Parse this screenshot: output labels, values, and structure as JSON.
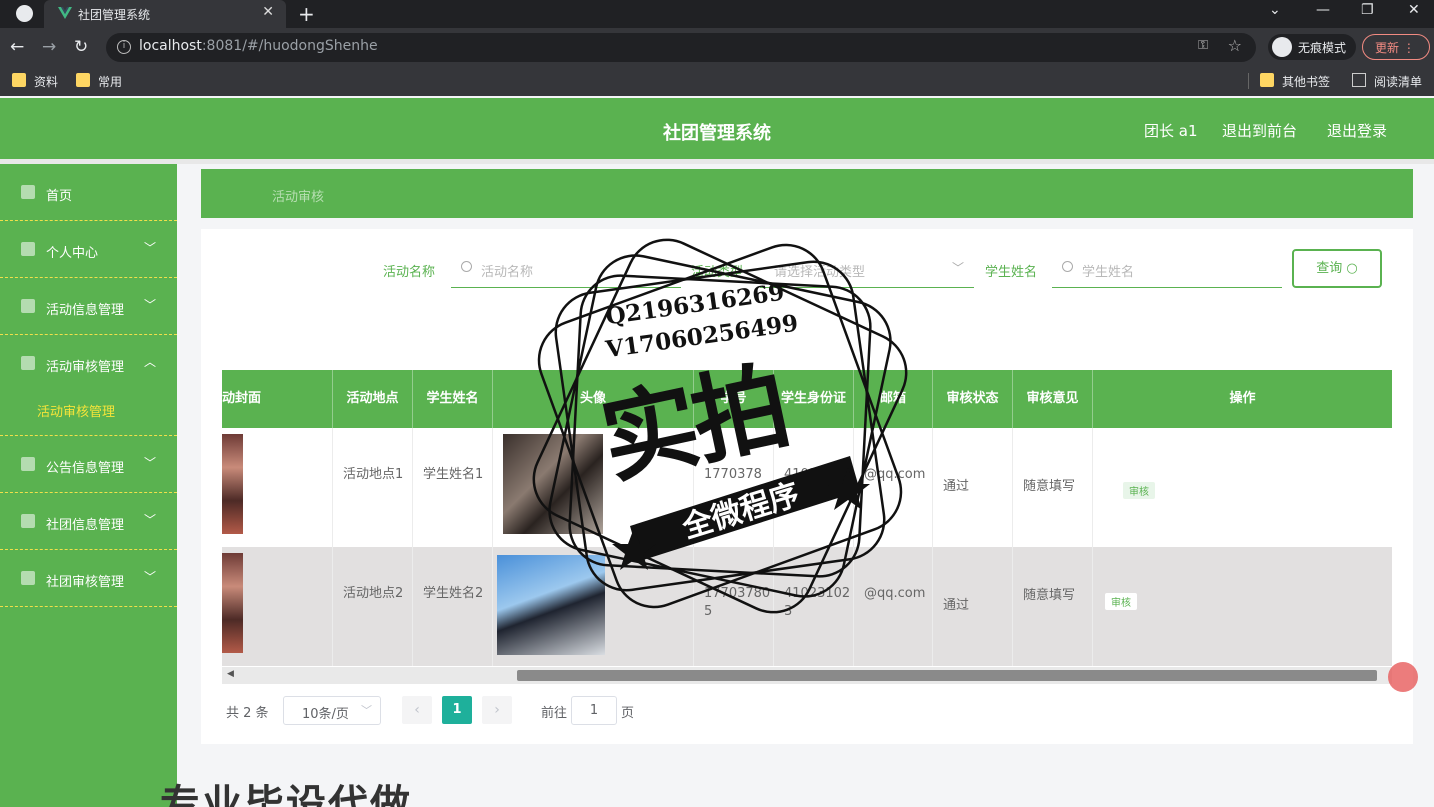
{
  "browser": {
    "tab_title": "社团管理系统",
    "url_host": "localhost",
    "url_rest": ":8081/#/huodongShenhe",
    "incognito_label": "无痕模式",
    "update_label": "更新",
    "bookmarks": [
      "资料",
      "常用"
    ],
    "other_bookmarks": "其他书签",
    "reading_list": "阅读清单"
  },
  "header": {
    "title": "社团管理系统",
    "user": "团长 a1",
    "to_front": "退出到前台",
    "logout": "退出登录"
  },
  "sidebar": {
    "items": [
      {
        "label": "首页",
        "icon": "home-icon"
      },
      {
        "label": "个人中心",
        "icon": "user-icon"
      },
      {
        "label": "活动信息管理",
        "icon": "activity-icon"
      },
      {
        "label": "活动审核管理",
        "icon": "audit-icon"
      },
      {
        "label": "公告信息管理",
        "icon": "notice-icon"
      },
      {
        "label": "社团信息管理",
        "icon": "club-icon"
      },
      {
        "label": "社团审核管理",
        "icon": "club-audit-icon"
      }
    ],
    "submenu_label": "活动审核管理"
  },
  "breadcrumb": "活动审核",
  "search": {
    "activity_name_label": "活动名称",
    "activity_name_placeholder": "活动名称",
    "activity_type_label": "活动类型",
    "activity_type_placeholder": "请选择活动类型",
    "student_name_label": "学生姓名",
    "student_name_placeholder": "学生姓名",
    "query_button": "查询"
  },
  "table": {
    "headers": [
      "动封面",
      "活动地点",
      "学生姓名",
      "头像",
      "学号",
      "学生身份证",
      "邮箱",
      "审核状态",
      "审核意见",
      "操作"
    ],
    "rows": [
      {
        "place": "活动地点1",
        "student": "学生姓名1",
        "student_id": "1770378",
        "id_card": "4102311023",
        "email": "@qq.com",
        "status": "通过",
        "opinion": "随意填写",
        "action": "审核"
      },
      {
        "place": "活动地点2",
        "student": "学生姓名2",
        "student_id": "177037805",
        "id_card": "410231023",
        "email": "@qq.com",
        "status": "通过",
        "opinion": "随意填写",
        "action": "审核"
      }
    ]
  },
  "pagination": {
    "total": "共 2 条",
    "page_size": "10条/页",
    "current": "1",
    "goto_label": "前往",
    "goto_value": "1",
    "page_suffix": "页"
  },
  "watermark": {
    "qq": "Q2196316269",
    "vx": "V17060256499",
    "big": "实拍",
    "ribbon": "全微程序",
    "bottom": "专业毕设代做"
  },
  "colors": {
    "primary": "#5ab250",
    "accent_yellow": "#f5e43a",
    "pagination_active": "#1eb09b"
  }
}
